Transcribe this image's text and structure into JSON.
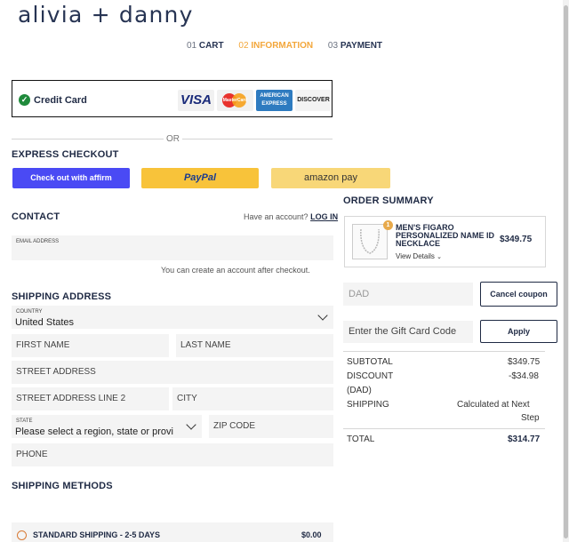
{
  "brand": {
    "logo": "alivia + danny"
  },
  "steps": [
    {
      "num": "01",
      "label": "CART"
    },
    {
      "num": "02",
      "label": "INFORMATION"
    },
    {
      "num": "03",
      "label": "PAYMENT"
    }
  ],
  "payment": {
    "credit_card_label": "Credit Card",
    "cards": [
      "VISA",
      "MasterCard",
      "AMERICAN EXPRESS",
      "DISCOVER"
    ],
    "or_text": "OR"
  },
  "express": {
    "heading": "EXPRESS CHECKOUT",
    "affirm_label": "Check out with affirm",
    "paypal_label": "PayPal",
    "amazon_label": "amazon pay"
  },
  "contact": {
    "heading": "CONTACT",
    "have_account": "Have an account?",
    "login_link": "LOG IN",
    "email_placeholder": "EMAIL ADDRESS",
    "note": "You can create an account after checkout."
  },
  "shipping": {
    "heading": "SHIPPING ADDRESS",
    "country_label": "COUNTRY",
    "country_value": "United States",
    "first_name": "FIRST NAME",
    "last_name": "LAST NAME",
    "street": "STREET ADDRESS",
    "street2": "STREET ADDRESS LINE 2",
    "city": "CITY",
    "state_label": "STATE",
    "state_value": "Please select a region, state or provi",
    "zip": "ZIP CODE",
    "phone": "PHONE"
  },
  "methods": {
    "heading": "SHIPPING METHODS",
    "option_label": "STANDARD SHIPPING - 2-5 DAYS",
    "option_price": "$0.00"
  },
  "summary": {
    "heading": "ORDER SUMMARY",
    "qty": "1",
    "product_name": "MEN'S FIGARO PERSONALIZED NAME ID NECKLACE",
    "view_details": "View Details",
    "product_price": "$349.75",
    "coupon_value": "DAD",
    "cancel_coupon": "Cancel coupon",
    "gift_placeholder": "Enter the Gift Card Code",
    "apply": "Apply",
    "subtotal_label": "SUBTOTAL",
    "subtotal_value": "$349.75",
    "discount_label": "DISCOUNT",
    "discount_code": "(DAD)",
    "discount_value": "-$34.98",
    "shipping_label": "SHIPPING",
    "shipping_value_1": "Calculated at Next",
    "shipping_value_2": "Step",
    "total_label": "TOTAL",
    "total_value": "$314.77"
  }
}
